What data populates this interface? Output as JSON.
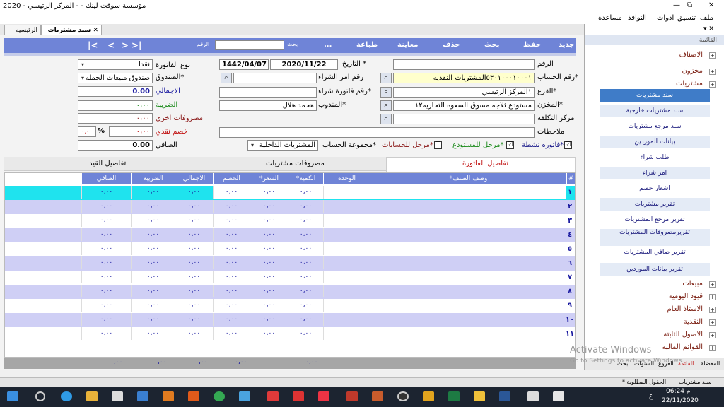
{
  "window": {
    "title": "مؤسسة سوفت لينك  - - المركز الرئيسي - 2020",
    "close": "✕",
    "restore": "⧉",
    "minimize": "—"
  },
  "menu": [
    "ملف",
    "تنسيق",
    "ادوات",
    "النوافذ",
    "مساعدة"
  ],
  "doc_tabs": {
    "active": "سند مشتريات",
    "other": "الرئيسيه",
    "close": "✕"
  },
  "toolbar": {
    "new": "جديد",
    "save": "حفظ",
    "search": "بحث",
    "delete": "حذف",
    "preview": "معاينة",
    "print": "طباعة",
    "more": "...",
    "search_label": "بحث",
    "number_label": "الرقم",
    "nav_first": "|<",
    "nav_prev": "<",
    "nav_next": ">",
    "nav_last": ">|"
  },
  "form": {
    "number_label": "الرقم",
    "date_label": "* التاريخ",
    "date_g": "2020/11/22",
    "date_h": "1442/04/07",
    "invoice_type_label": "نوع الفاتورة",
    "invoice_type": "نقدا",
    "account_label": "*رقم الحساب",
    "account_value": "٥٣٠١٠٠٠١٠٠٠١المشتريات النقديه",
    "po_label": "رقم امر الشراء",
    "fund_label": "*الصندوق",
    "fund_value": "صندوق مبيعات الجمله",
    "branch_label": "*الفرع",
    "branch_value": "١المركز الرئيسي",
    "purchase_inv_label": "*رقم فاتورة شراء",
    "total_label": "الاجمالي",
    "total_value": "0.00",
    "store_label": "*المخزن",
    "store_value": "مستودع ثلاجه مسوق السعوه التجاريه١٢",
    "rep_label": "*المندوب",
    "rep_value": "محمد هلال",
    "tax_label": "الضريبة",
    "tax_value": "٠،٠٠",
    "cost_center_label": "مركز التكلفه",
    "other_exp_label": "مصروفات اخري",
    "other_exp_value": "٠،٠٠",
    "notes_label": "ملاحظات",
    "discount_label": "خصم نقدي",
    "discount_value": "٠،٠٠",
    "discount_pct": "٠،٠٠",
    "pct_sign": "%",
    "net_label": "الصافي",
    "net_value": "0.00",
    "active_label": "*فاتوره نشطة",
    "posted_store_label": "*مرحل للمستودع",
    "posted_acc_label": "*مرحل للحسابات",
    "account_group_label": "*مجموعة الحساب",
    "account_group_value": "المشتريات الداخلية",
    "check": "☑",
    "uncheck": "☐",
    "lookup": "⌕",
    "arrow": "▾"
  },
  "detail_tabs": [
    "تفاصيل الفاتورة",
    "مصروفات مشتريات",
    "تفاصيل القيد"
  ],
  "grid": {
    "headers": [
      "#",
      "وصف الصنف*",
      "الوحدة",
      "الكمية*",
      "السعر*",
      "الخصم",
      "الاجمالي",
      "الضريبة",
      "الصافي"
    ],
    "rows": [
      "١",
      "٢",
      "٣",
      "٤",
      "٥",
      "٦",
      "٧",
      "٨",
      "٩",
      "١٠",
      "١١"
    ],
    "zero": "٠،٠٠",
    "footer": [
      "٠،٠٠",
      "٠،٠٠",
      "٠،٠٠",
      "٠،٠٠",
      "٠،٠٠"
    ]
  },
  "sidebar": {
    "pin": "▾ ✕",
    "header": "القائمة",
    "groups_top": [
      "الاصناف",
      "مخزون",
      "مشتريات"
    ],
    "items": [
      "سند مشتريات",
      "سند مشتريات خارجية",
      "سند مرجع مشتريات",
      "بيانات الموردين",
      "طلب شراء",
      "امر شراء",
      "اشعار خصم",
      "تقرير مشتريات",
      "تقرير مرجع المشتريات",
      "تقريرمصروفات المشتريات",
      "تقرير صافي المشتريات",
      "تقرير بيانات الموردين"
    ],
    "groups_bottom": [
      "مبيعات",
      "قيود اليومية",
      "الاستاذ العام",
      "النقدية",
      "الاصول الثابتة",
      "القوائم المالية"
    ],
    "tabs": [
      "المفضلة",
      "القائمة",
      "الفروع",
      "السنوات",
      "بحث"
    ]
  },
  "status": {
    "left": "سند مشتريات",
    "right": "* الحقول المطلوبة"
  },
  "watermark": {
    "line1": "Activate Windows",
    "line2": "Go to Settings to activate Windows."
  },
  "taskbar": {
    "time": "06:24 م",
    "date": "22/11/2020",
    "lang": "ع"
  }
}
